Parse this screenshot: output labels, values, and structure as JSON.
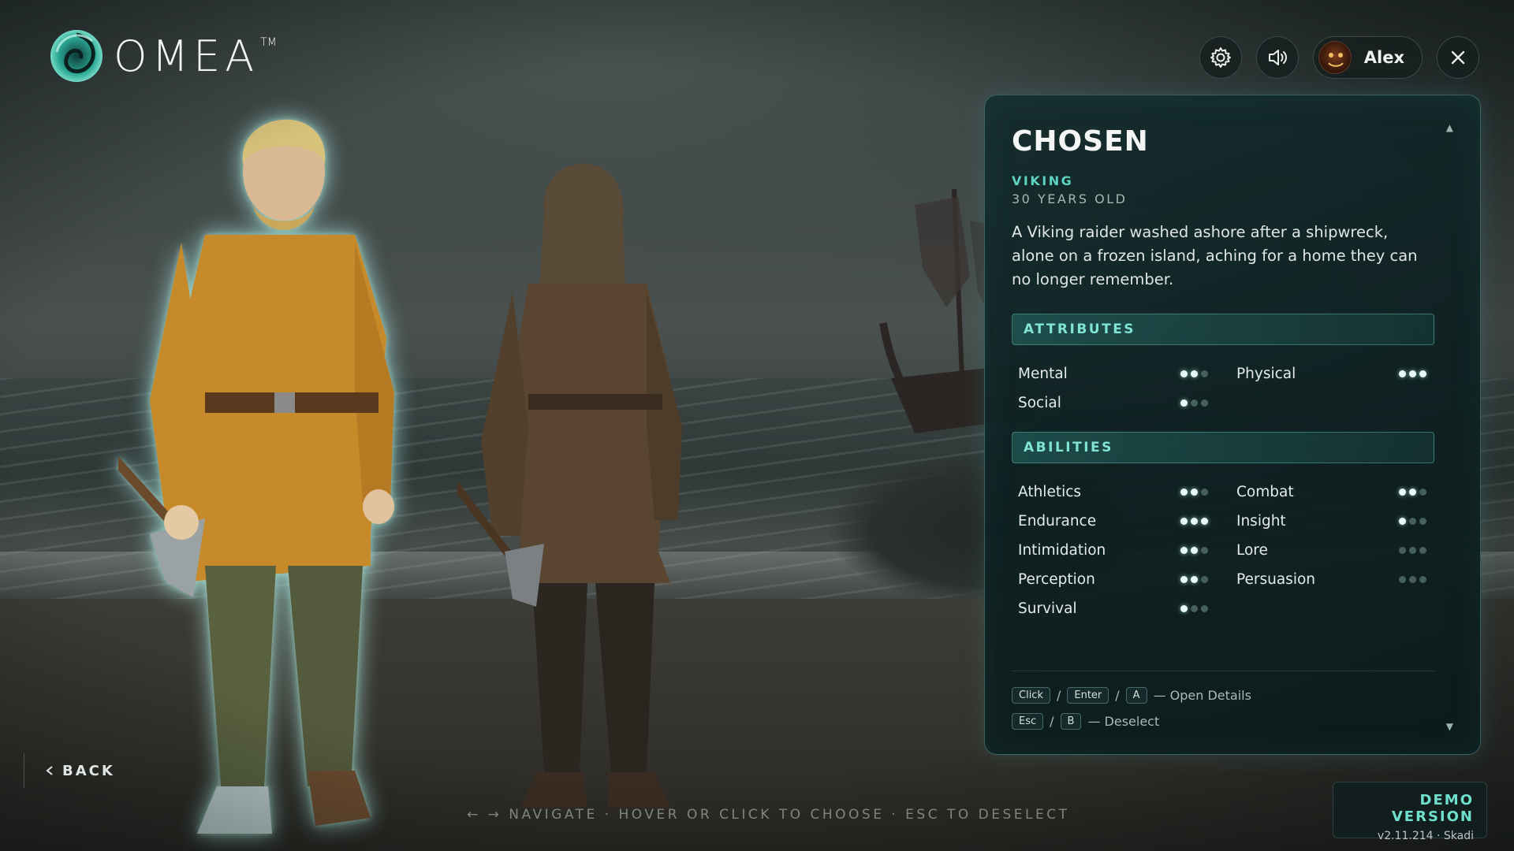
{
  "brand": {
    "name": "OMEA",
    "trademark": "TM"
  },
  "header": {
    "settings_icon": "gear-icon",
    "sound_icon": "speaker-icon",
    "close_icon": "close-icon",
    "user": {
      "name": "Alex"
    }
  },
  "character": {
    "name": "CHOSEN",
    "class": "VIKING",
    "age": "30 YEARS OLD",
    "description": "A Viking raider washed ashore after a shipwreck, alone on a frozen island, aching for a home they can no longer remember."
  },
  "attributes": {
    "title": "ATTRIBUTES",
    "items": [
      {
        "label": "Mental",
        "level": 2,
        "max": 3
      },
      {
        "label": "Physical",
        "level": 3,
        "max": 3
      },
      {
        "label": "Social",
        "level": 1,
        "max": 3
      }
    ]
  },
  "abilities": {
    "title": "ABILITIES",
    "items": [
      {
        "label": "Athletics",
        "level": 2,
        "max": 3
      },
      {
        "label": "Combat",
        "level": 2,
        "max": 3
      },
      {
        "label": "Endurance",
        "level": 3,
        "max": 3
      },
      {
        "label": "Insight",
        "level": 1,
        "max": 3
      },
      {
        "label": "Intimidation",
        "level": 2,
        "max": 3
      },
      {
        "label": "Lore",
        "level": 0,
        "max": 3
      },
      {
        "label": "Perception",
        "level": 2,
        "max": 3
      },
      {
        "label": "Persuasion",
        "level": 0,
        "max": 3
      },
      {
        "label": "Survival",
        "level": 1,
        "max": 3
      }
    ]
  },
  "hints": {
    "open": {
      "keys": [
        "Click",
        "Enter",
        "A"
      ],
      "separator": "/",
      "action": "— Open Details"
    },
    "deselect": {
      "keys": [
        "Esc",
        "B"
      ],
      "separator": "/",
      "action": "— Deselect"
    }
  },
  "back": {
    "label": "BACK"
  },
  "footer": {
    "hint": "← → NAVIGATE · HOVER OR CLICK TO CHOOSE · ESC TO DESELECT"
  },
  "demo": {
    "title": "DEMO VERSION",
    "version": "v2.11.214 · Skadi"
  },
  "colors": {
    "accent": "#5fd3c1",
    "panel": "#102a2b",
    "tunic_left": "#c78a2a",
    "tunic_right": "#5a4630"
  }
}
